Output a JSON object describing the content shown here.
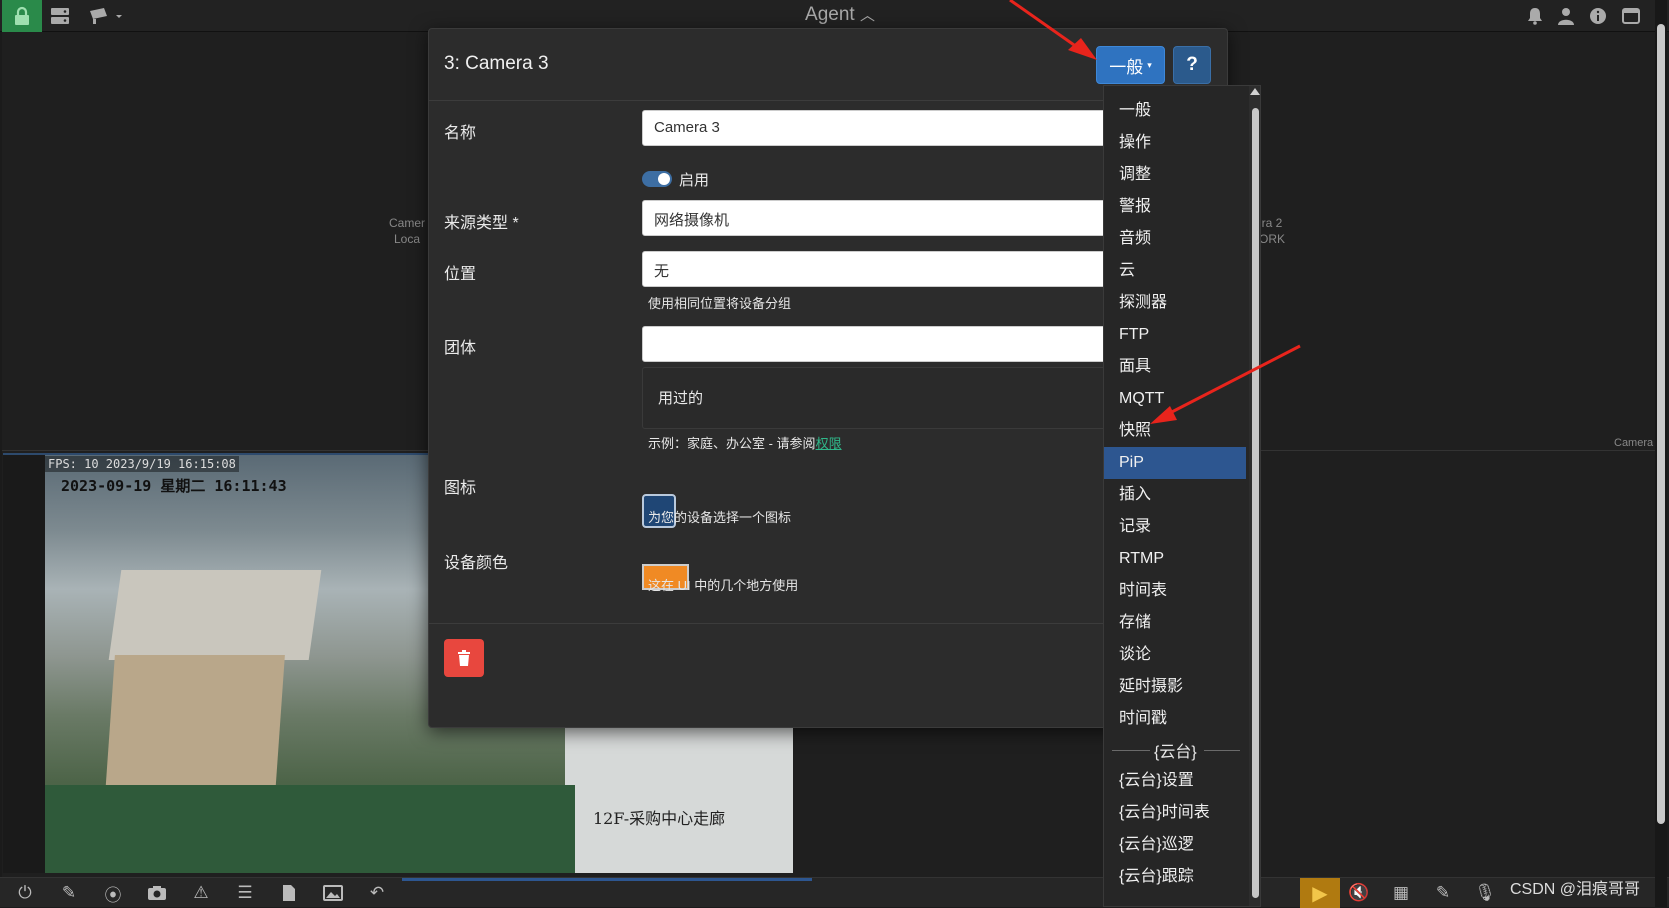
{
  "topbar": {
    "title": "Agent",
    "title_caret": "⌃",
    "icons": [
      "lock-icon",
      "server-icon",
      "camera-icon",
      "bell-icon",
      "user-icon",
      "info-icon",
      "window-icon"
    ]
  },
  "background_tiles": {
    "left_label_line1": "Camer",
    "left_label_line2": "Loca",
    "right_label_line1": "ra 2",
    "right_label_line2": "ORK",
    "corner_label": "Camera"
  },
  "camera_feed": {
    "fps_overlay": "FPS: 10 2023/9/19 16:15:08",
    "osd_time": "2023-09-19 星期二 16:11:43",
    "osd_name": "12F-采购中心走廊"
  },
  "dialog": {
    "title": "3: Camera 3",
    "general_button": "一般",
    "help_button": "?",
    "fields": {
      "name_label": "名称",
      "name_value": "Camera 3",
      "enabled_label": "启用",
      "source_label": "来源类型 *",
      "source_value": "网络摄像机",
      "location_label": "位置",
      "location_value": "无",
      "location_hint": "使用相同位置将设备分组",
      "group_label": "团体",
      "group_value": "",
      "used_label": "用过的",
      "group_hint_prefix": "示例：家庭、办公室 - 请参阅",
      "group_hint_link": "权限",
      "icon_label": "图标",
      "icon_button": "...",
      "icon_hint": "为您的设备选择一个图标",
      "color_label": "设备颜色",
      "color_value": "#f08a24",
      "color_hint": "这在 UI 中的几个地方使用"
    }
  },
  "menu": {
    "items": [
      "一般",
      "操作",
      "调整",
      "警报",
      "音频",
      "云",
      "探测器",
      "FTP",
      "面具",
      "MQTT",
      "快照",
      "PiP",
      "插入",
      "记录",
      "RTMP",
      "时间表",
      "存储",
      "谈论",
      "延时摄影",
      "时间戳"
    ],
    "active": "PiP",
    "separator": "{云台}",
    "ptz_items": [
      "{云台}设置",
      "{云台}时间表",
      "{云台}巡逻",
      "{云台}跟踪"
    ]
  },
  "watermark": "CSDN @泪痕哥哥",
  "colors": {
    "accent": "#2f73c0",
    "active_menu": "#2d5690",
    "delete": "#e8473e",
    "lock": "#2a8a4a",
    "annotation_arrow": "#e8241c"
  }
}
